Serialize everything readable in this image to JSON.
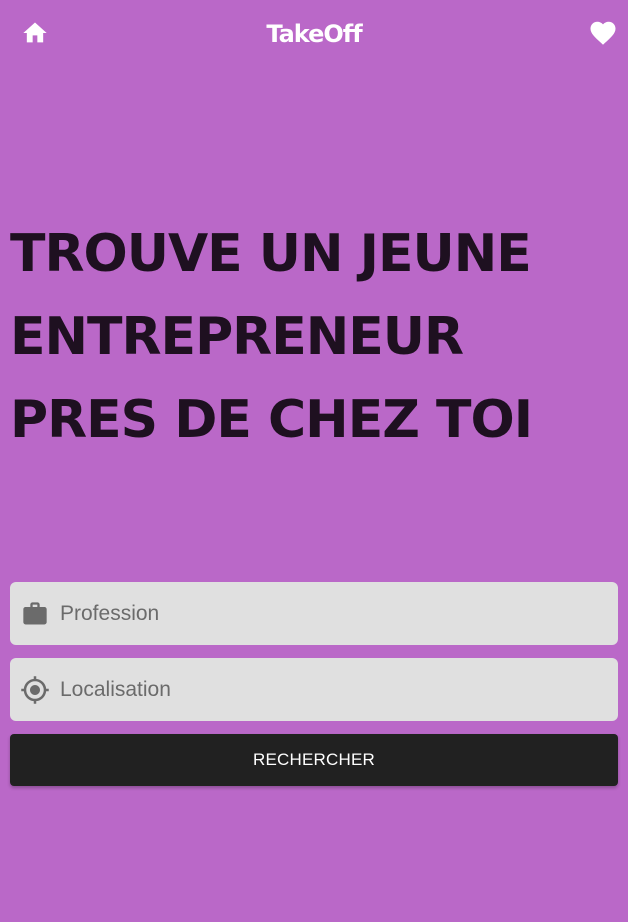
{
  "app_bar": {
    "title": "TakeOff",
    "home_icon": "home-icon",
    "favorite_icon": "heart-icon"
  },
  "hero": {
    "headline": "TROUVE UN JEUNE ENTREPRENEUR PRES DE CHEZ TOI"
  },
  "search_form": {
    "profession": {
      "value": "",
      "placeholder": "Profession",
      "icon": "briefcase-icon"
    },
    "location": {
      "value": "",
      "placeholder": "Localisation",
      "icon": "location-target-icon"
    },
    "submit_label": "RECHERCHER"
  },
  "colors": {
    "background": "#ba68c8",
    "headline": "#1e1020",
    "field_background": "#e0e0e0",
    "button_background": "#212121",
    "button_text": "#ffffff"
  }
}
